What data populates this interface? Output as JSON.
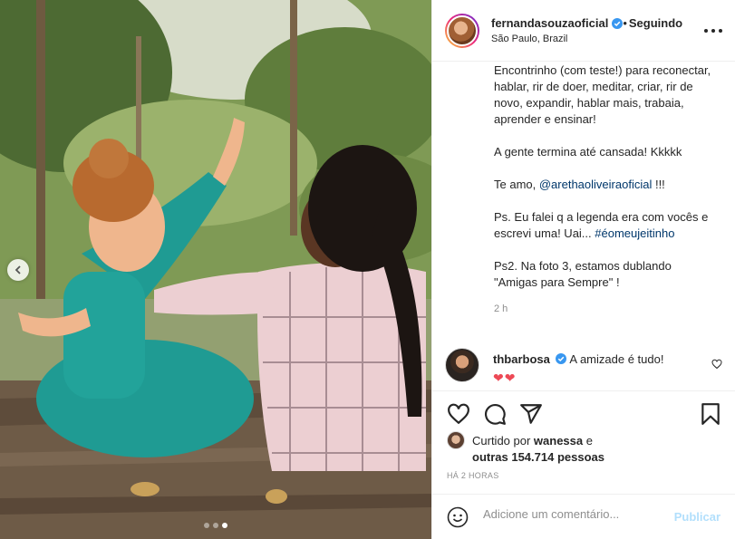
{
  "post": {
    "image_alt": "",
    "carousel": {
      "total": 3,
      "active_index": 2
    }
  },
  "header": {
    "username": "fernandasouzaoficial",
    "separator": " • ",
    "following_label": "Seguindo",
    "location": "São Paulo, Brazil",
    "verified": true
  },
  "caption": {
    "line1": "Encontrinho (com teste!) para reconectar, hablar, rir de doer, meditar, criar, rir de novo, expandir, hablar mais, trabaia, aprender e ensinar!",
    "line2": "A gente termina até cansada! Kkkkk",
    "line3_prefix": "Te amo, ",
    "line3_mention": "@arethaoliveiraoficial",
    "line3_suffix": " !!!",
    "line4_prefix": "Ps. Eu falei q a legenda era com vocês e escrevi uma! Uai... ",
    "line4_hashtag": "#éomeujeitinho",
    "line5": "Ps2. Na foto 3, estamos dublando \"Amigas para Sempre\" !",
    "timestamp": "2 h"
  },
  "comment": {
    "username": "thbarbosa",
    "text": " A amizade é tudo!",
    "hearts": "❤❤",
    "verified": true
  },
  "likes": {
    "prefix": "Curtido por ",
    "first_user": "wanessa",
    "connector": " e",
    "others": "outras 154.714 pessoas"
  },
  "age": "HÁ 2 HORAS",
  "add_comment": {
    "placeholder": "Adicione um comentário...",
    "publish_label": "Publicar"
  },
  "colors": {
    "link": "#00376b",
    "heart": "#ed4956",
    "publish_disabled": "#b2dffc",
    "muted": "#8e8e8e"
  },
  "icons": [
    "chevron-left-icon",
    "verified-icon",
    "more-icon",
    "heart-icon",
    "comment-icon",
    "share-icon",
    "bookmark-icon",
    "emoji-icon"
  ]
}
